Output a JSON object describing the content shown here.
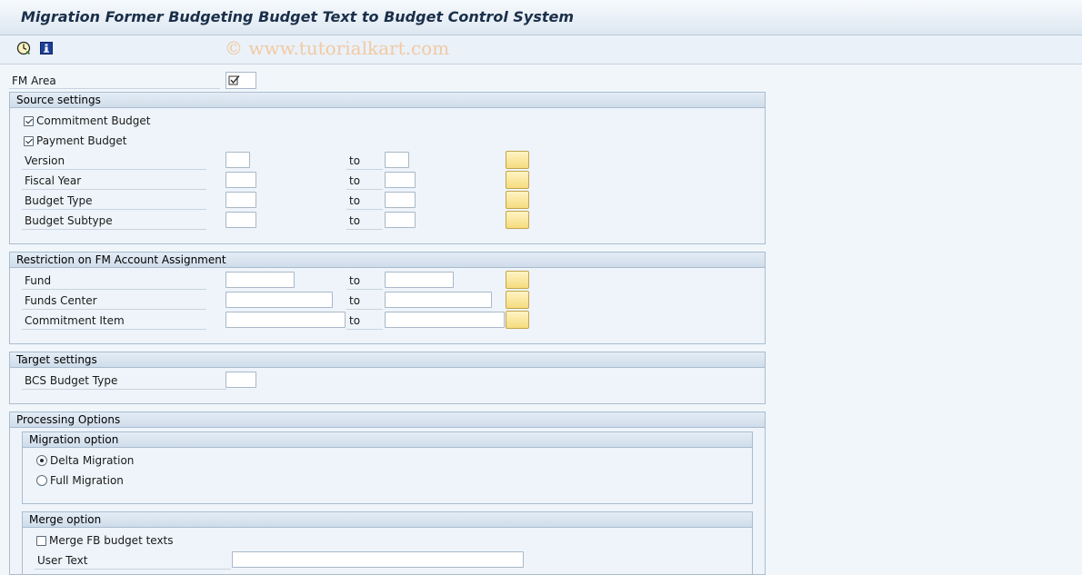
{
  "window": {
    "title": "Migration Former Budgeting Budget Text to Budget Control System"
  },
  "toolbar": {
    "icons": [
      "execute-icon",
      "info-icon"
    ],
    "watermark": "© www.tutorialkart.com"
  },
  "fm_area": {
    "label": "FM Area",
    "icon": "checkbox-icon"
  },
  "source_settings": {
    "title": "Source settings",
    "commitment_budget": {
      "label": "Commitment Budget",
      "checked": true
    },
    "payment_budget": {
      "label": "Payment Budget",
      "checked": true
    },
    "rows": [
      {
        "label": "Version",
        "to": "to"
      },
      {
        "label": "Fiscal Year",
        "to": "to"
      },
      {
        "label": "Budget Type",
        "to": "to"
      },
      {
        "label": "Budget Subtype",
        "to": "to"
      }
    ]
  },
  "restriction": {
    "title": "Restriction on FM Account Assignment",
    "rows": [
      {
        "label": "Fund",
        "to": "to"
      },
      {
        "label": "Funds Center",
        "to": "to"
      },
      {
        "label": "Commitment Item",
        "to": "to"
      }
    ]
  },
  "target_settings": {
    "title": "Target settings",
    "bcs_budget_type": {
      "label": "BCS Budget Type"
    }
  },
  "processing_options": {
    "title": "Processing Options",
    "migration_option": {
      "title": "Migration option",
      "delta": {
        "label": "Delta Migration",
        "selected": true
      },
      "full": {
        "label": "Full Migration",
        "selected": false
      }
    },
    "merge_option": {
      "title": "Merge option",
      "merge_fb": {
        "label": "Merge FB budget texts",
        "checked": false
      },
      "user_text": {
        "label": "User Text"
      }
    }
  }
}
